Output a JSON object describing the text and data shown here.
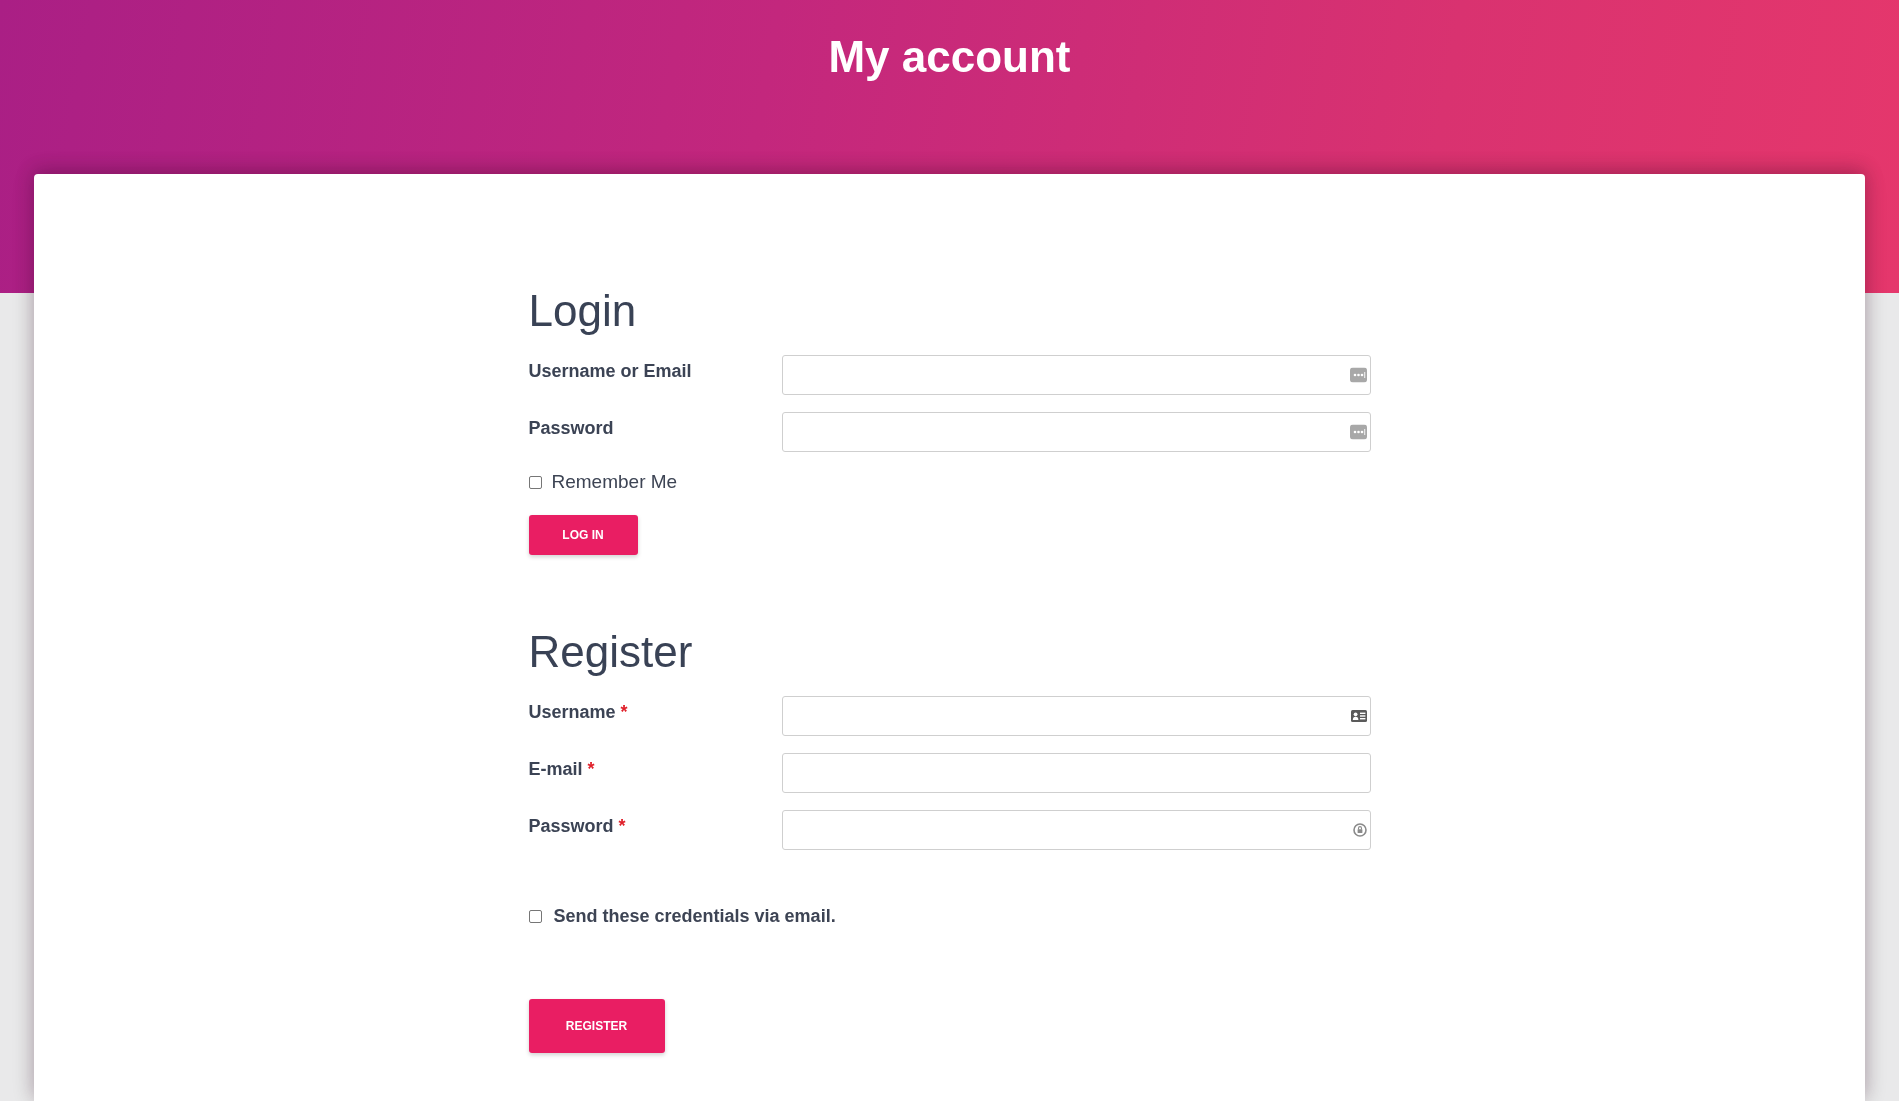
{
  "page": {
    "title": "My account"
  },
  "login": {
    "heading": "Login",
    "fields": [
      {
        "label": "Username or Email",
        "kind": "saved_login"
      },
      {
        "label": "Password",
        "kind": "saved_login"
      }
    ],
    "remember": {
      "label": "Remember Me",
      "checked": false
    },
    "button": "LOG IN"
  },
  "register": {
    "heading": "Register",
    "fields": [
      {
        "label": "Username",
        "required_mark": "*",
        "kind": "identity"
      },
      {
        "label": "E-mail",
        "required_mark": "*",
        "kind": "plain"
      },
      {
        "label": "Password",
        "required_mark": "*",
        "kind": "new_password"
      }
    ],
    "send_credentials": {
      "label": "Send these credentials via email.",
      "checked": false
    },
    "button": "REGISTER"
  }
}
